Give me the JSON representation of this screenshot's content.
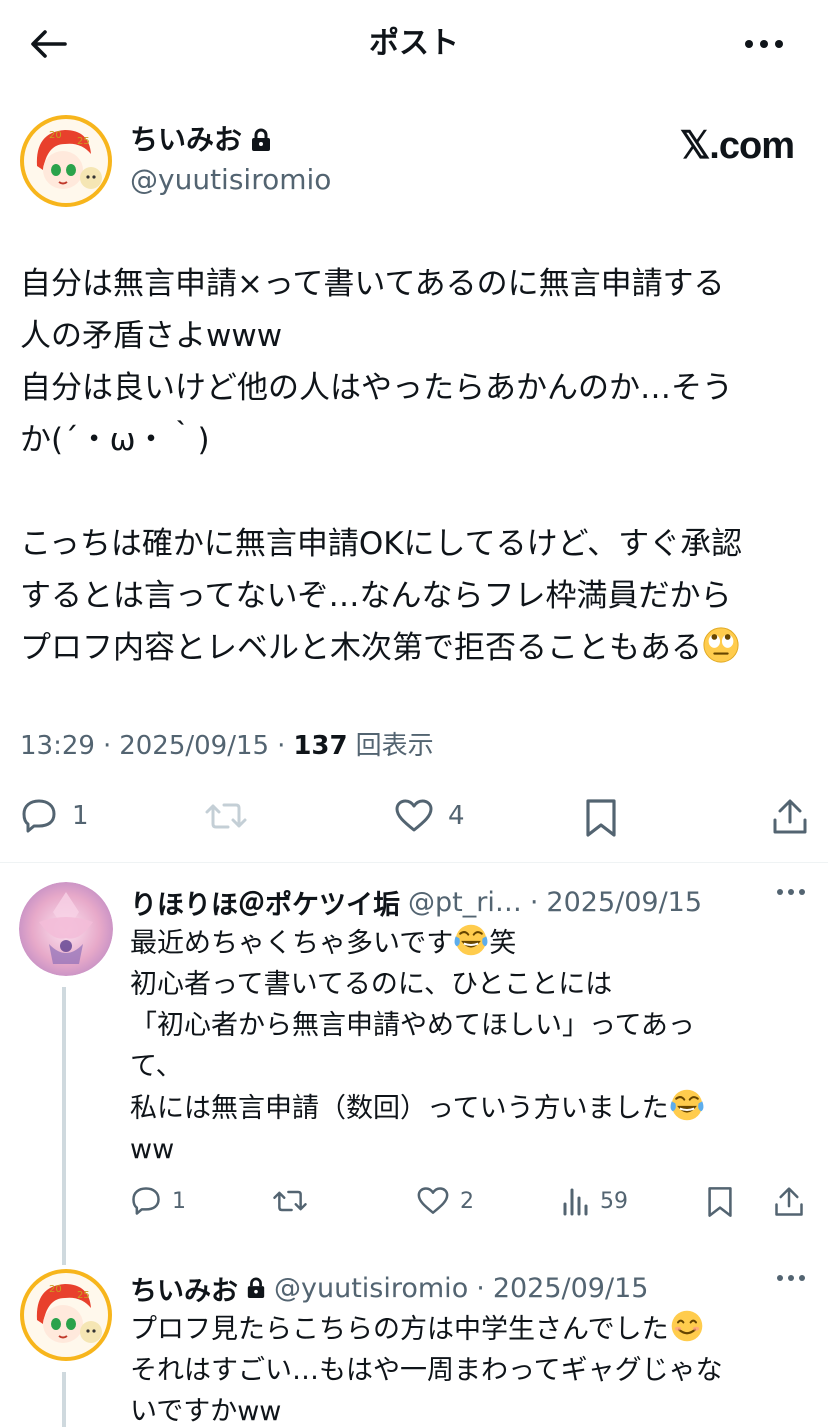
{
  "header": {
    "title": "ポスト"
  },
  "main_post": {
    "author": {
      "name": "ちいみお",
      "handle": "@yuutisiromio"
    },
    "brand": "𝕏.com",
    "text_p1": "自分は無言申請×って書いてあるのに無言申請する\n人の矛盾さよwww\n自分は良いけど他の人はやったらあかんのか…そう\nか(´・ω・｀)\n\nこっちは確かに無言申請OKにしてるけど、すぐ承認\nするとは言ってないぞ…なんならフレ枠満員だから\nプロフ内容とレベルと木次第で拒否ることもある",
    "time": "13:29",
    "date": "2025/09/15",
    "views_count": "137",
    "views_label": "回表示",
    "sep": "·",
    "actions": {
      "replies": "1",
      "likes": "4"
    }
  },
  "replies": [
    {
      "name": "りほりほ＠ポケツイ垢",
      "handle": "@pt_ri…",
      "sep": "·",
      "date": "2025/09/15",
      "text_a": "最近めちゃくちゃ多いです",
      "text_b": "笑\n初心者って書いてるのに、ひとことには\n「初心者から無言申請やめてほしい」ってあっ\nて、\n私には無言申請（数回）っていう方いました",
      "text_c": "\nww",
      "actions": {
        "replies": "1",
        "likes": "2",
        "views": "59"
      }
    },
    {
      "name": "ちいみお",
      "handle": "@yuutisiromio",
      "sep": "·",
      "date": "2025/09/15",
      "text_a": "プロフ見たらこちらの方は中学生さんでした",
      "text_b": "\nそれはすごい…もはや一周まわってギャグじゃな\nいですかww"
    }
  ],
  "colors": {
    "text": "#0f1419",
    "secondary": "#536471",
    "divider": "#eff3f4",
    "thread": "#cfd9de"
  },
  "icons": [
    "back-arrow-icon",
    "more-icon",
    "lock-icon",
    "reply-icon",
    "retweet-icon",
    "like-icon",
    "bookmark-icon",
    "share-icon",
    "views-icon",
    "rolling-eyes-emoji",
    "tears-of-joy-emoji",
    "smiling-emoji"
  ]
}
